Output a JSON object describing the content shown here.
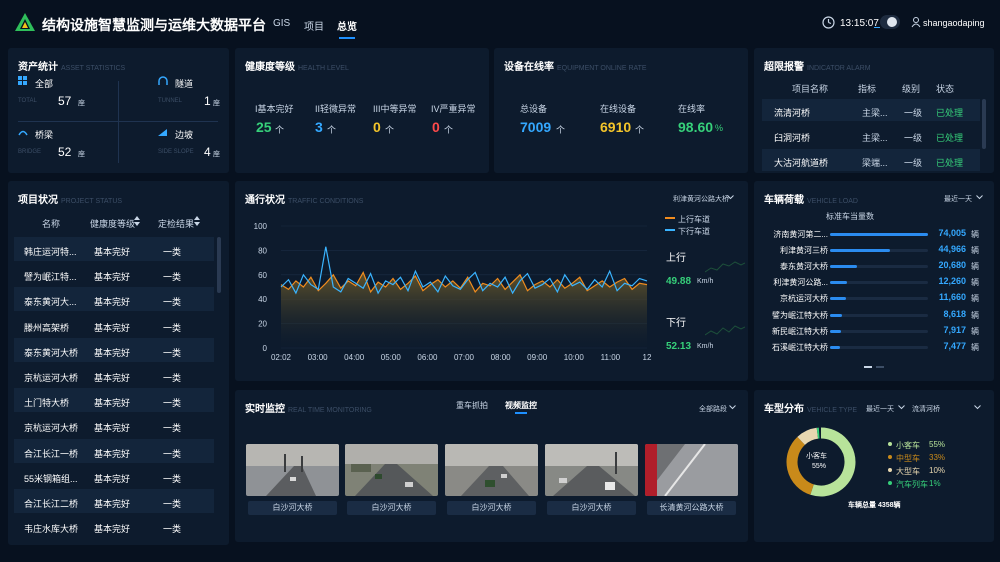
{
  "header": {
    "title": "结构设施智慧监测与运维大数据平台",
    "nav": [
      "GIS",
      "项目",
      "总览"
    ],
    "active_nav": "总览",
    "time": "13:15:07",
    "username": "shangaodaping"
  },
  "asset": {
    "title": "资产统计",
    "title_en": "ASSET STATISTICS",
    "items": [
      {
        "label": "全部",
        "en": "TOTAL",
        "value": "57",
        "unit": "座"
      },
      {
        "label": "隧道",
        "en": "TUNNEL",
        "value": "1",
        "unit": "座"
      },
      {
        "label": "桥梁",
        "en": "BRIDGE",
        "value": "52",
        "unit": "座"
      },
      {
        "label": "边坡",
        "en": "SIDE SLOPE",
        "value": "4",
        "unit": "座"
      }
    ]
  },
  "health": {
    "title": "健康度等级",
    "title_en": "HEALTH LEVEL",
    "items": [
      {
        "label": "I基本完好",
        "value": "25",
        "unit": "个",
        "color": "#36d07a"
      },
      {
        "label": "II轻微异常",
        "value": "3",
        "unit": "个",
        "color": "#34a8ff"
      },
      {
        "label": "III中等异常",
        "value": "0",
        "unit": "个",
        "color": "#f4c52a"
      },
      {
        "label": "IV严重异常",
        "value": "0",
        "unit": "个",
        "color": "#ff4a4a"
      }
    ]
  },
  "equipment": {
    "title": "设备在线率",
    "title_en": "EQUIPMENT ONLINE RATE",
    "items": [
      {
        "label": "总设备",
        "value": "7009",
        "unit": "个",
        "color": "#34a8ff"
      },
      {
        "label": "在线设备",
        "value": "6910",
        "unit": "个",
        "color": "#f4c52a"
      },
      {
        "label": "在线率",
        "value": "98.60",
        "unit": "%",
        "color": "#36d07a"
      }
    ]
  },
  "alarm": {
    "title": "超限报警",
    "title_en": "INDICATOR ALARM",
    "headers": [
      "项目名称",
      "指标",
      "级别",
      "状态"
    ],
    "rows": [
      [
        "流清河桥",
        "主梁...",
        "一级",
        "已处理"
      ],
      [
        "臼洞河桥",
        "主梁...",
        "一级",
        "已处理"
      ],
      [
        "大沽河航道桥",
        "梁端...",
        "一级",
        "已处理"
      ]
    ]
  },
  "projects": {
    "title": "项目状况",
    "title_en": "PROJECT STATUS",
    "headers": [
      "名称",
      "健康度等级",
      "定检结果"
    ],
    "rows": [
      [
        "韩庄运河特...",
        "基本完好",
        "一类"
      ],
      [
        "譬为岷江特...",
        "基本完好",
        "一类"
      ],
      [
        "泰东黄河大...",
        "基本完好",
        "一类"
      ],
      [
        "滕州高架桥",
        "基本完好",
        "一类"
      ],
      [
        "泰东黄河大桥",
        "基本完好",
        "一类"
      ],
      [
        "京杭运河大桥",
        "基本完好",
        "一类"
      ],
      [
        "土门特大桥",
        "基本完好",
        "一类"
      ],
      [
        "京杭运河大桥",
        "基本完好",
        "一类"
      ],
      [
        "合江长江一桥",
        "基本完好",
        "一类"
      ],
      [
        "55米钢箱组...",
        "基本完好",
        "一类"
      ],
      [
        "合江长江二桥",
        "基本完好",
        "一类"
      ],
      [
        "韦庄水库大桥",
        "基本完好",
        "一类"
      ]
    ]
  },
  "traffic": {
    "title": "通行状况",
    "title_en": "TRAFFIC CONDITIONS",
    "selector": "利津黄河公路大桥",
    "legend": [
      "上行车道",
      "下行车道"
    ],
    "up_label": "上行",
    "up_value": "49.88",
    "up_unit": "Km/h",
    "down_label": "下行",
    "down_value": "52.13",
    "down_unit": "Km/h"
  },
  "chart_data": {
    "type": "line",
    "x": [
      "02:02",
      "03:00",
      "04:00",
      "05:00",
      "06:00",
      "07:00",
      "08:00",
      "09:00",
      "10:00",
      "11:00",
      "12"
    ],
    "ylim": [
      0,
      100
    ],
    "yticks": [
      0,
      20,
      40,
      60,
      80,
      100
    ],
    "series": [
      {
        "name": "上行车道",
        "color": "#f08c1e",
        "values": [
          52,
          48,
          55,
          50,
          58,
          47,
          53,
          60,
          49,
          55,
          51,
          62,
          46,
          54,
          50,
          57,
          48,
          53,
          59,
          47,
          52,
          56,
          50,
          55,
          49,
          58,
          46,
          53,
          51,
          57,
          48,
          54,
          60,
          47,
          52,
          55,
          50,
          56,
          49,
          53,
          58,
          47,
          51,
          55,
          50,
          54,
          57,
          48,
          53,
          52
        ]
      },
      {
        "name": "下行车道",
        "color": "#3ab4ff",
        "values": [
          50,
          56,
          45,
          60,
          52,
          48,
          83,
          50,
          46,
          57,
          53,
          49,
          61,
          45,
          55,
          52,
          58,
          47,
          63,
          50,
          54,
          46,
          59,
          51,
          48,
          56,
          62,
          47,
          53,
          50,
          58,
          45,
          55,
          61,
          49,
          52,
          57,
          46,
          60,
          51,
          54,
          48,
          56,
          50,
          63,
          47,
          53,
          51,
          57,
          55
        ]
      }
    ]
  },
  "vehicle_load": {
    "title": "车辆荷载",
    "title_en": "VEHICLE LOAD",
    "range": "最近一天",
    "subtitle": "标准车当量数",
    "unit": "辆",
    "rows": [
      {
        "name": "济南黄河第二...",
        "value": "74,005",
        "ratio": 1.0
      },
      {
        "name": "利津黄河三桥",
        "value": "44,966",
        "ratio": 0.61
      },
      {
        "name": "泰东黄河大桥",
        "value": "20,680",
        "ratio": 0.28
      },
      {
        "name": "利津黄河公路...",
        "value": "12,260",
        "ratio": 0.17
      },
      {
        "name": "京杭运河大桥",
        "value": "11,660",
        "ratio": 0.16
      },
      {
        "name": "譬为岷江特大桥",
        "value": "8,618",
        "ratio": 0.12
      },
      {
        "name": "新民岷江特大桥",
        "value": "7,917",
        "ratio": 0.11
      },
      {
        "name": "石溪岷江特大桥",
        "value": "7,477",
        "ratio": 0.1
      }
    ]
  },
  "monitor": {
    "title": "实时监控",
    "title_en": "REAL TIME MONITORING",
    "tabs": [
      "重车抓拍",
      "视频监控"
    ],
    "active_tab": "视频监控",
    "filter": "全部路段",
    "cameras": [
      "白沙河大桥",
      "白沙河大桥",
      "白沙河大桥",
      "白沙河大桥",
      "长清黄河公路大桥"
    ]
  },
  "vehicle_type": {
    "title": "车型分布",
    "title_en": "VEHICLE TYPE",
    "range": "最近一天",
    "bridge": "流清河桥",
    "center_label": "小客车",
    "center_value": "55%",
    "total_label": "车辆总量 4358辆",
    "items": [
      {
        "label": "小客车",
        "value": "55%",
        "fraction": 0.55,
        "color": "#b8e39a"
      },
      {
        "label": "中型车",
        "value": "33%",
        "fraction": 0.33,
        "color": "#c98a1a"
      },
      {
        "label": "大型车",
        "value": "10%",
        "fraction": 0.1,
        "color": "#e8d7b0"
      },
      {
        "label": "汽车列车",
        "value": "1%",
        "fraction": 0.01,
        "color": "#36d07a"
      }
    ]
  }
}
